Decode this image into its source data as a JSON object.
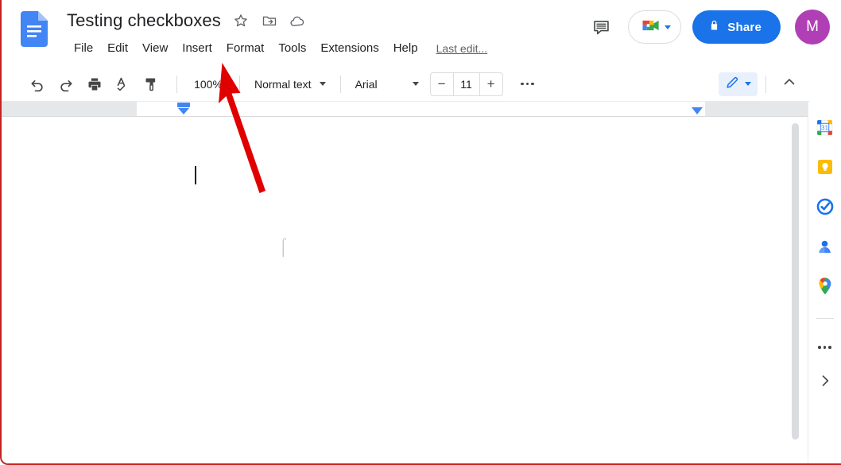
{
  "app": {
    "name": "Google Docs"
  },
  "header": {
    "logo_icon": "docs-logo-icon",
    "doc_title": "Testing checkboxes",
    "title_actions": [
      {
        "name": "star-icon",
        "label": "Star"
      },
      {
        "name": "move-to-folder-icon",
        "label": "Move"
      },
      {
        "name": "cloud-saved-icon",
        "label": "Saved to Drive"
      }
    ],
    "menus": [
      "File",
      "Edit",
      "View",
      "Insert",
      "Format",
      "Tools",
      "Extensions",
      "Help"
    ],
    "last_edit": "Last edit...",
    "comment_icon": "comment-history-icon",
    "meet_icon": "google-meet-icon",
    "share_label": "Share",
    "share_lock_icon": "lock-icon",
    "share_color": "#1a73e8",
    "avatar_initial": "M",
    "avatar_color": "#b03fb5"
  },
  "toolbar": {
    "undo_icon": "undo-icon",
    "redo_icon": "redo-icon",
    "print_icon": "print-icon",
    "spellcheck_icon": "spellcheck-icon",
    "paint_format_icon": "paint-format-icon",
    "zoom_value": "100%",
    "paragraph_style": "Normal text",
    "font_family": "Arial",
    "font_size": "11",
    "decrease_font_label": "−",
    "increase_font_label": "+",
    "more_icon": "more-horizontal-icon",
    "mode_icon": "editing-mode-pencil-icon",
    "collapse_icon": "chevron-up-icon"
  },
  "ruler": {
    "left_indent_marker": "left-indent-marker",
    "right_indent_marker": "right-indent-marker"
  },
  "document": {
    "outline_icon": "show-document-outline-icon",
    "body_text": "",
    "caret_visible": true
  },
  "right_rail": {
    "items": [
      {
        "name": "google-calendar-icon",
        "label": "Calendar",
        "day": "31"
      },
      {
        "name": "google-keep-icon",
        "label": "Keep"
      },
      {
        "name": "google-tasks-icon",
        "label": "Tasks"
      },
      {
        "name": "google-contacts-icon",
        "label": "Contacts"
      },
      {
        "name": "google-maps-icon",
        "label": "Maps"
      }
    ],
    "more_label": "More",
    "expand_label": "Show side panel"
  },
  "annotation": {
    "arrow_color": "#e00000",
    "points_to": "Insert"
  }
}
